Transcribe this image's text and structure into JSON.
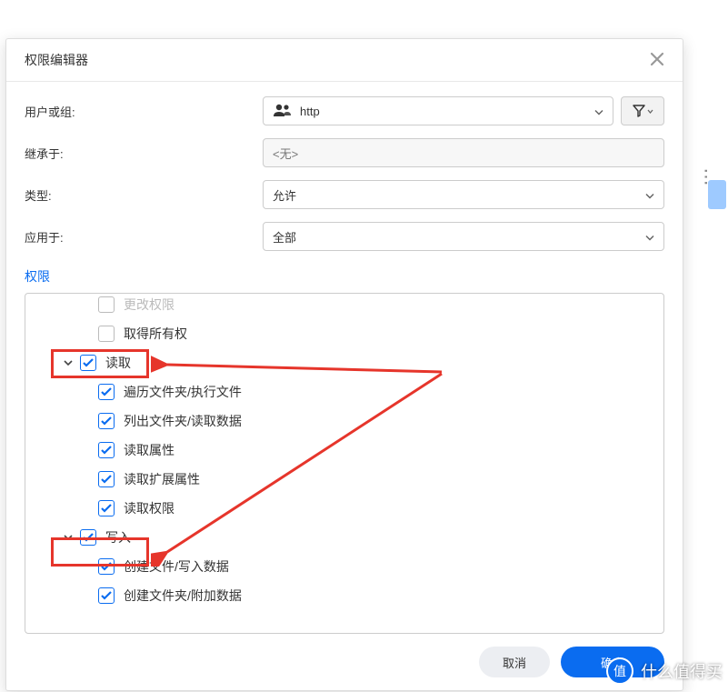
{
  "modal": {
    "title": "权限编辑器"
  },
  "form": {
    "user_label": "用户或组:",
    "user_value": "http",
    "inherit_label": "继承于:",
    "inherit_value": "<无>",
    "type_label": "类型:",
    "type_value": "允许",
    "apply_label": "应用于:",
    "apply_value": "全部"
  },
  "section": {
    "permissions_label": "权限"
  },
  "perms": {
    "p0": "更改权限",
    "p1": "取得所有权",
    "p2": "读取",
    "p2a": "遍历文件夹/执行文件",
    "p2b": "列出文件夹/读取数据",
    "p2c": "读取属性",
    "p2d": "读取扩展属性",
    "p2e": "读取权限",
    "p3": "写入",
    "p3a": "创建文件/写入数据",
    "p3b": "创建文件夹/附加数据"
  },
  "buttons": {
    "cancel": "取消",
    "ok": "确定"
  },
  "watermark": {
    "badge": "值",
    "text": "什么值得买"
  }
}
